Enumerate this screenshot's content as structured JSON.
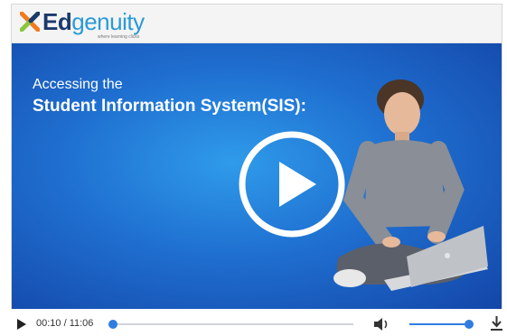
{
  "brand": {
    "name_part1": "Ed",
    "name_part2": "genuity",
    "tagline": "where learning clicks",
    "colors": {
      "navy": "#1a3a6b",
      "blue": "#2a9ad6",
      "orange": "#f07c1f",
      "green": "#8cc63f"
    },
    "icon": "edgenuity-x-logo"
  },
  "video": {
    "title_line1": "Accessing the",
    "title_line2": "Student Information System(SIS):",
    "play_icon": "play-circle-icon",
    "background_color": "#1f6fd0"
  },
  "controls": {
    "play_icon": "play-icon",
    "time": "00:10 / 11:06",
    "progress_fraction": 0.0015,
    "volume_icon": "volume-icon",
    "volume_fraction": 1.0,
    "download_icon": "download-icon",
    "accent_color": "#2f7de1"
  }
}
